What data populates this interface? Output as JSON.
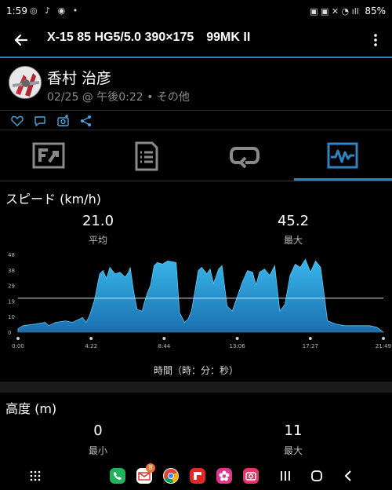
{
  "status_bar": {
    "time": "1:59",
    "left_icons": "◎ ♪ ◉ •",
    "right_icons": "▣ ▣ ✕ ◔ ıll",
    "battery": "85%"
  },
  "app_bar": {
    "title": "X-15 85 HG5/5.0 390×175",
    "title_suffix": "99MK II"
  },
  "author": {
    "name": "香村 治彦",
    "meta": "02/25 @ 午後0:22 • その他"
  },
  "tabs": [
    {
      "name": "summary",
      "active": false
    },
    {
      "name": "details",
      "active": false
    },
    {
      "name": "route",
      "active": false
    },
    {
      "name": "charts",
      "active": true
    }
  ],
  "speed": {
    "title": "スピード (km/h)",
    "avg_value": "21.0",
    "avg_label": "平均",
    "max_value": "45.2",
    "max_label": "最大"
  },
  "chart_data": {
    "type": "area",
    "ylim": [
      0,
      48
    ],
    "y_ticks": [
      "48",
      "38",
      "29",
      "19",
      "10",
      "0"
    ],
    "x_ticks": [
      "0:00",
      "4:22",
      "8:44",
      "13:06",
      "17:27",
      "21:49"
    ],
    "xlabel": "時間（時：分：秒）",
    "average_line": 21.0,
    "color": "#29a9e0",
    "x": [
      0,
      0.3,
      1.0,
      1.6,
      1.8,
      2.2,
      2.8,
      3.2,
      3.8,
      4.0,
      4.2,
      4.5,
      4.8,
      5.0,
      5.2,
      5.4,
      5.7,
      6.0,
      6.3,
      6.5,
      6.6,
      6.8,
      7.0,
      7.3,
      7.4,
      7.6,
      7.8,
      8.0,
      8.2,
      8.5,
      8.8,
      9.3,
      9.5,
      9.8,
      10.0,
      10.2,
      10.4,
      10.6,
      10.8,
      11.1,
      11.3,
      11.5,
      11.8,
      12.0,
      12.3,
      12.6,
      12.9,
      13.2,
      13.5,
      13.8,
      14.0,
      14.2,
      14.5,
      14.8,
      15.1,
      15.4,
      15.7,
      16.0,
      16.3,
      16.6,
      16.9,
      17.2,
      17.5,
      17.8,
      18.2,
      18.7,
      19.2,
      19.6,
      20.2,
      20.7,
      21.1,
      21.49
    ],
    "y": [
      2,
      4,
      5,
      6,
      4,
      6,
      7,
      6,
      9,
      6,
      10,
      20,
      36,
      38,
      33,
      40,
      36,
      37,
      34,
      37,
      40,
      25,
      14,
      13,
      17,
      24,
      29,
      41,
      43,
      42,
      44,
      43,
      12,
      6,
      8,
      13,
      25,
      38,
      40,
      36,
      39,
      30,
      39,
      41,
      16,
      13,
      22,
      31,
      38,
      37,
      29,
      37,
      39,
      35,
      41,
      13,
      17,
      35,
      42,
      40,
      45,
      37,
      44,
      40,
      7,
      5,
      4,
      4,
      4,
      4,
      3,
      0
    ]
  },
  "altitude": {
    "title": "高度 (m)",
    "min_value": "0",
    "min_label": "最小",
    "max_value": "11",
    "max_label": "最大"
  },
  "nav_apps": [
    "phone-app",
    "mail-app",
    "chrome-app",
    "flipboard-app",
    "flower-app",
    "camera-app"
  ],
  "mail_badge": "8"
}
